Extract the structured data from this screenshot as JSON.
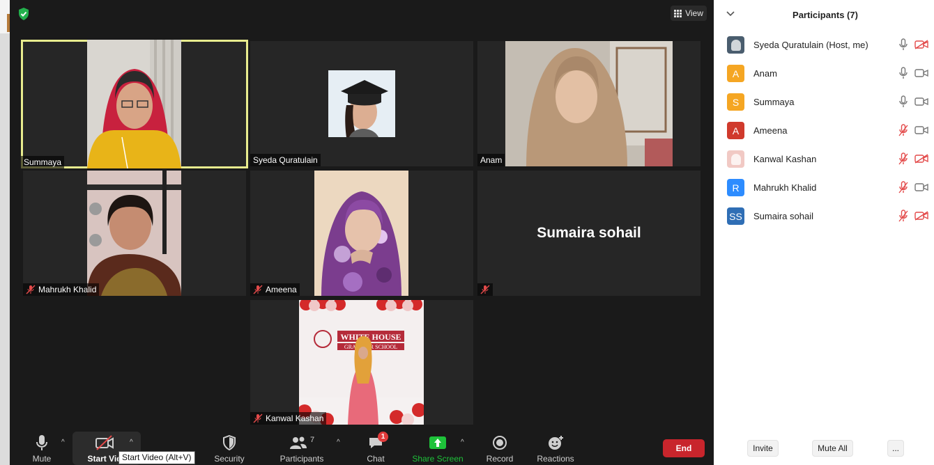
{
  "view_label": "View",
  "tiles": [
    {
      "name": "Summaya",
      "muted": false
    },
    {
      "name": "Syeda Quratulain",
      "muted": false
    },
    {
      "name": "Anam",
      "muted": false
    },
    {
      "name": "Mahrukh Khalid",
      "muted": true
    },
    {
      "name": "Ameena",
      "muted": true
    },
    {
      "name": "Sumaira sohail",
      "muted": true
    },
    {
      "name": "Kanwal Kashan",
      "muted": true
    }
  ],
  "video_text": {
    "banner_line1": "WHITE HOUSE",
    "banner_line2": "GRAMMAR SCHOOL"
  },
  "toolbar": {
    "mute": "Mute",
    "start_video": "Start Vid",
    "security": "Security",
    "participants": "Participants",
    "participants_count": "7",
    "chat": "Chat",
    "chat_badge": "1",
    "share_screen": "Share Screen",
    "record": "Record",
    "reactions": "Reactions",
    "end": "End",
    "tooltip": "Start Video (Alt+V)"
  },
  "panel": {
    "title": "Participants (7)",
    "participants": [
      {
        "name": "Syeda Quratulain (Host, me)",
        "avatar_letter": "",
        "avatar_color": "#4a5d6e",
        "mic_muted": false,
        "cam_off": true
      },
      {
        "name": "Anam",
        "avatar_letter": "A",
        "avatar_color": "#f5a623",
        "mic_muted": false,
        "cam_off": false
      },
      {
        "name": "Summaya",
        "avatar_letter": "S",
        "avatar_color": "#f5a623",
        "mic_muted": false,
        "cam_off": false
      },
      {
        "name": "Ameena",
        "avatar_letter": "A",
        "avatar_color": "#d03a2c",
        "mic_muted": true,
        "cam_off": false
      },
      {
        "name": "Kanwal Kashan",
        "avatar_letter": "",
        "avatar_color": "#f1c9c4",
        "mic_muted": true,
        "cam_off": true
      },
      {
        "name": "Mahrukh Khalid",
        "avatar_letter": "R",
        "avatar_color": "#2d8cff",
        "mic_muted": true,
        "cam_off": false
      },
      {
        "name": "Sumaira sohail",
        "avatar_letter": "SS",
        "avatar_color": "#2f6eb5",
        "mic_muted": true,
        "cam_off": true
      }
    ],
    "invite": "Invite",
    "mute_all": "Mute All",
    "more": "..."
  },
  "colors": {
    "active_speaker": "#e8ec8e",
    "end_button": "#c8252c",
    "share_green": "#1ec23a",
    "muted_red": "#e34a4a"
  }
}
